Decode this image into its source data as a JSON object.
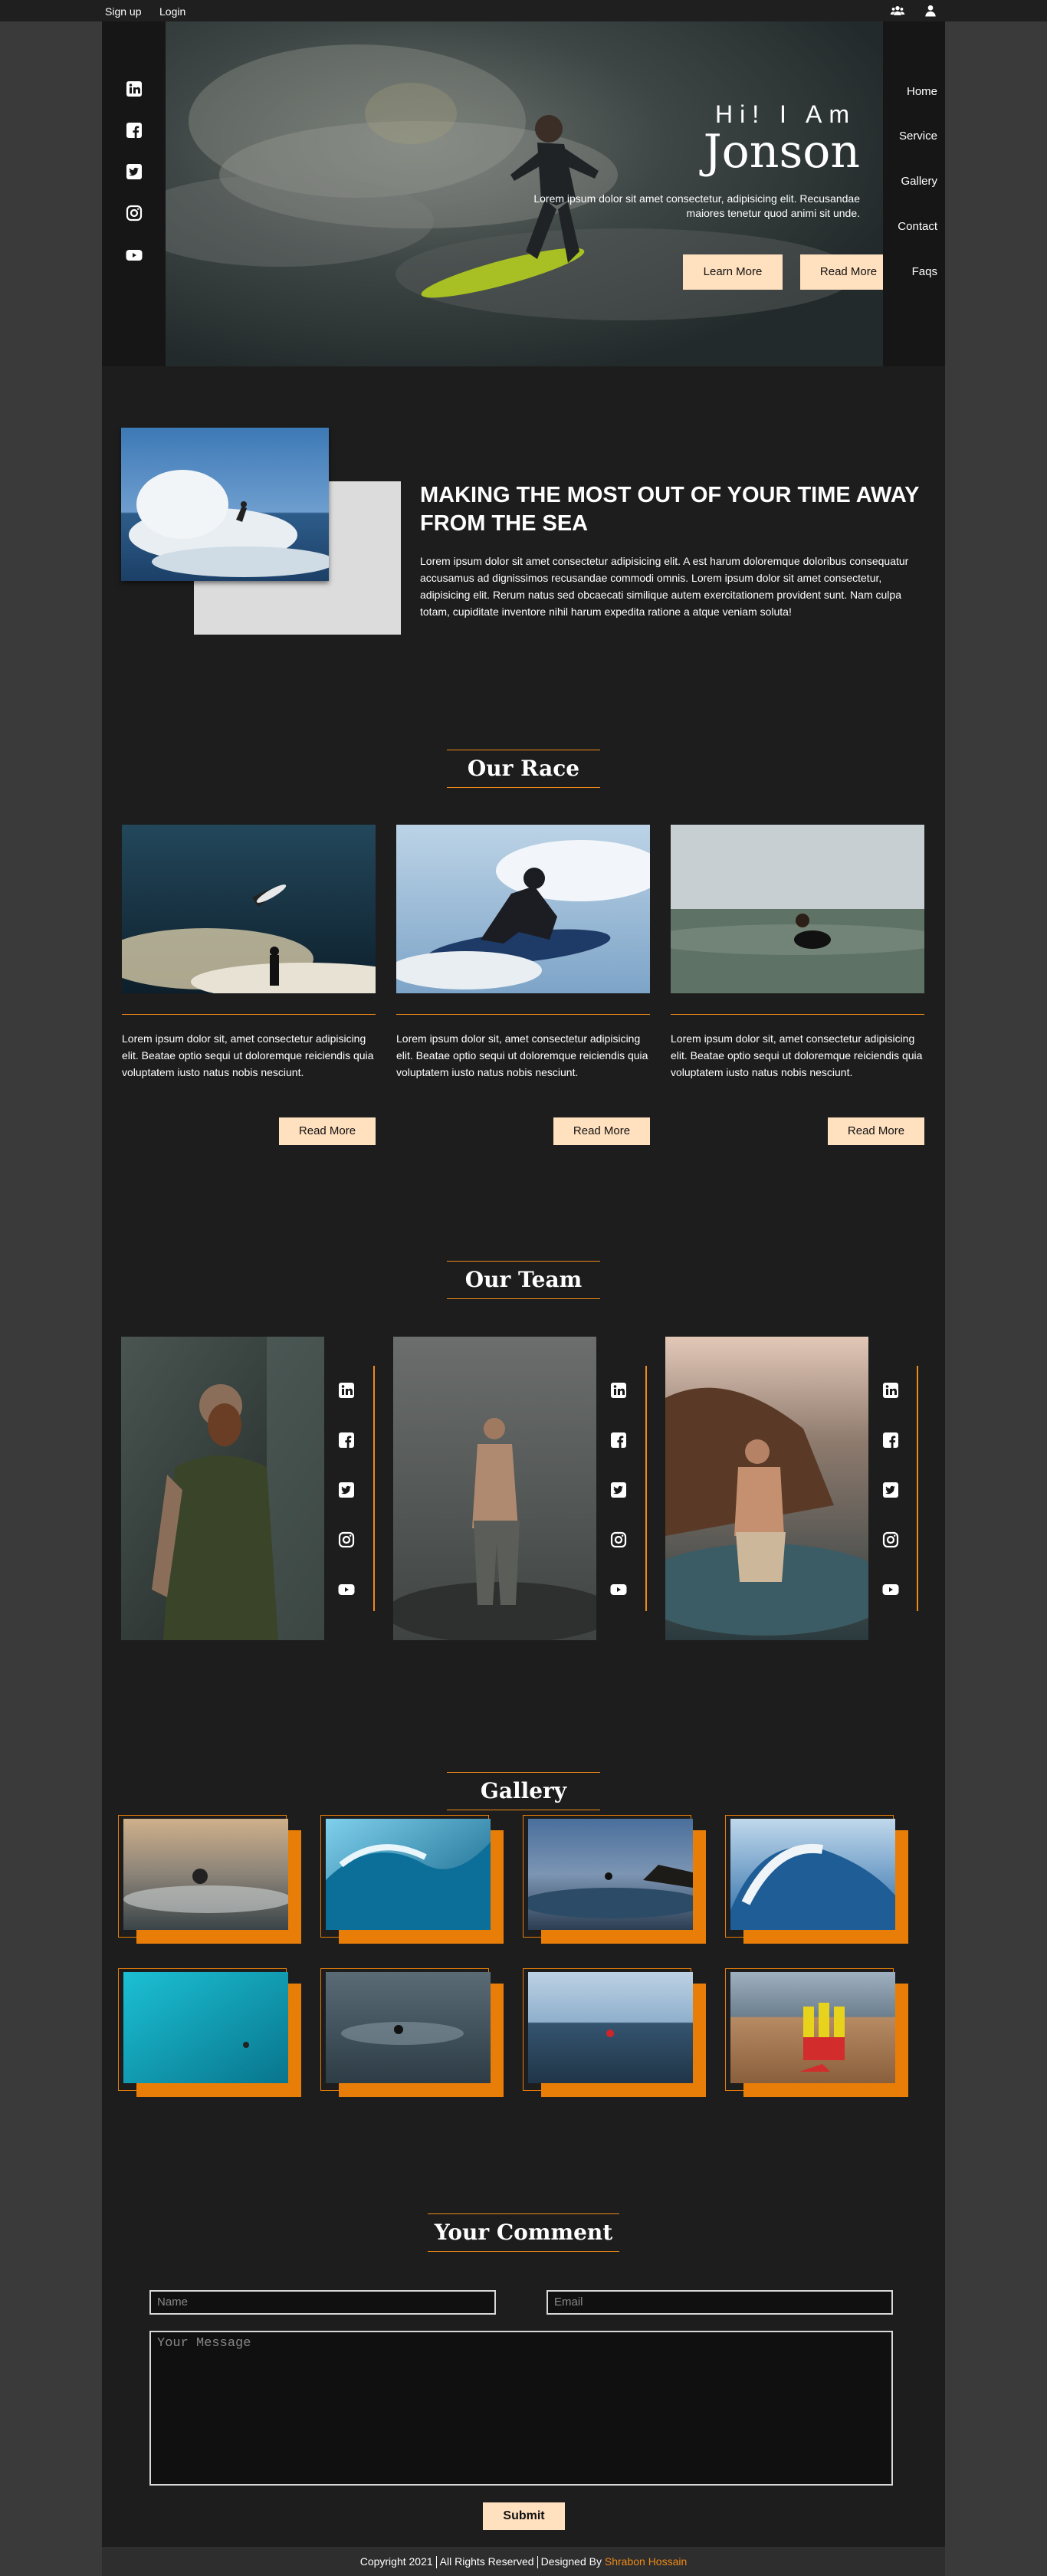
{
  "topbar": {
    "signup": "Sign up",
    "login": "Login",
    "icons": [
      "users-icon",
      "user-icon"
    ]
  },
  "hero": {
    "greeting": "Hi! I Am",
    "name": "Jonson",
    "text": "Lorem ipsum dolor sit amet consectetur, adipisicing elit. Recusandae maiores tenetur quod animi sit unde.",
    "btn_learn": "Learn More",
    "btn_read": "Read More",
    "social_icons": [
      "linkedin-icon",
      "facebook-icon",
      "twitter-icon",
      "instagram-icon",
      "youtube-icon"
    ]
  },
  "nav": {
    "items": [
      "Home",
      "Service",
      "Gallery",
      "Contact",
      "Faqs"
    ]
  },
  "about": {
    "title": "MAKING THE MOST OUT OF YOUR TIME AWAY FROM THE SEA",
    "text": "Lorem ipsum dolor sit amet consectetur adipisicing elit. A est harum doloremque doloribus consequatur accusamus ad dignissimos recusandae commodi omnis. Lorem ipsum dolor sit amet consectetur, adipisicing elit. Rerum natus sed obcaecati similique autem exercitationem provident sunt. Nam culpa totam, cupiditate inventore nihil harum expedita ratione a atque veniam soluta!"
  },
  "race": {
    "heading": "Our Race",
    "cards": [
      {
        "text": "Lorem ipsum dolor sit, amet consectetur adipisicing elit. Beatae optio sequi ut doloremque reiciendis quia voluptatem iusto natus nobis nesciunt.",
        "btn": "Read More"
      },
      {
        "text": "Lorem ipsum dolor sit, amet consectetur adipisicing elit. Beatae optio sequi ut doloremque reiciendis quia voluptatem iusto natus nobis nesciunt.",
        "btn": "Read More"
      },
      {
        "text": "Lorem ipsum dolor sit, amet consectetur adipisicing elit. Beatae optio sequi ut doloremque reiciendis quia voluptatem iusto natus nobis nesciunt.",
        "btn": "Read More"
      }
    ]
  },
  "team": {
    "heading": "Our Team"
  },
  "gallery": {
    "heading": "Gallery"
  },
  "comment": {
    "heading": "Your Comment",
    "name_placeholder": "Name",
    "email_placeholder": "Email",
    "message_placeholder": "Your Message",
    "submit": "Submit"
  },
  "footer": {
    "copyright": "Copyright 2021",
    "rights": "All Rights Reserved",
    "designed_by": "Designed By",
    "designer": "Shrabon Hossain"
  },
  "colors": {
    "accent": "#ef8a17",
    "button": "#ffe0bf",
    "panel": "#1d1d1d",
    "background": "#3a3a3a"
  }
}
